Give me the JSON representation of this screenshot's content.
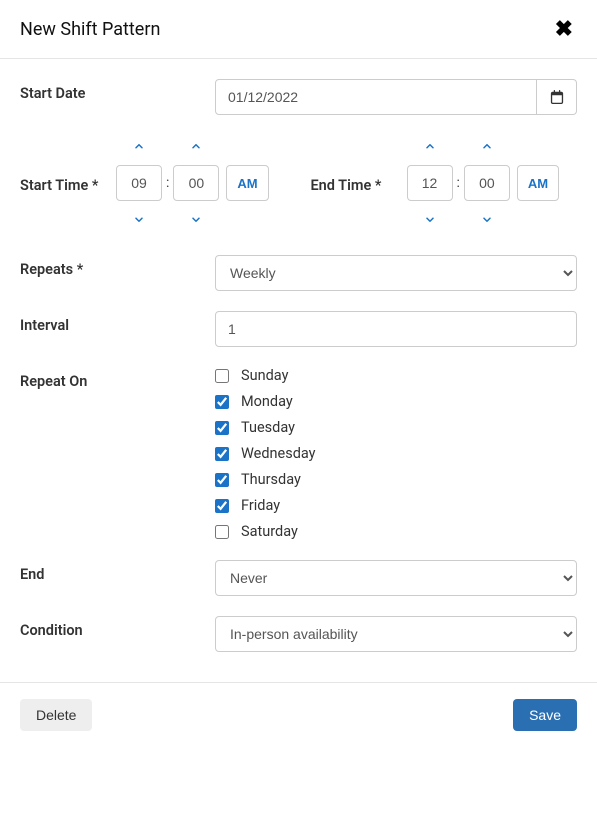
{
  "header": {
    "title": "New Shift Pattern"
  },
  "labels": {
    "start_date": "Start Date",
    "start_time": "Start Time *",
    "end_time": "End Time *",
    "repeats": "Repeats *",
    "interval": "Interval",
    "repeat_on": "Repeat On",
    "end": "End",
    "condition": "Condition"
  },
  "values": {
    "start_date": "01/12/2022",
    "start_time_hour": "09",
    "start_time_minute": "00",
    "start_time_period": "AM",
    "end_time_hour": "12",
    "end_time_minute": "00",
    "end_time_period": "AM",
    "repeats": "Weekly",
    "interval": "1",
    "end": "Never",
    "condition": "In-person availability"
  },
  "days": [
    {
      "label": "Sunday",
      "checked": false
    },
    {
      "label": "Monday",
      "checked": true
    },
    {
      "label": "Tuesday",
      "checked": true
    },
    {
      "label": "Wednesday",
      "checked": true
    },
    {
      "label": "Thursday",
      "checked": true
    },
    {
      "label": "Friday",
      "checked": true
    },
    {
      "label": "Saturday",
      "checked": false
    }
  ],
  "footer": {
    "delete": "Delete",
    "save": "Save"
  }
}
